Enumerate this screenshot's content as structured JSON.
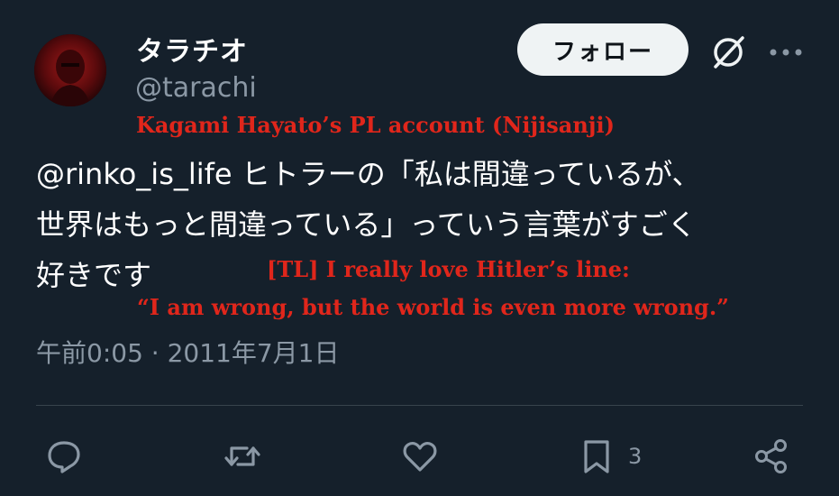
{
  "tweet": {
    "display_name": "タラチオ",
    "handle": "@tarachi",
    "follow_label": "フォロー",
    "text_lines": [
      "@rinko_is_life ヒトラーの「私は間違っているが、",
      "世界はもっと間違っている」っていう言葉がすごく",
      "好きです"
    ],
    "timestamp": "午前0:05 · 2011年7月1日"
  },
  "overlay": {
    "title": "Kagami Hayato’s PL account (Nijisanji)",
    "translation_line1": "[TL] I really love Hitler’s line:",
    "translation_line2": "“I am wrong, but the world is even more wrong.”"
  },
  "actions": {
    "bookmark_count": "3"
  },
  "icons": {
    "header": [
      "grok-icon",
      "more-icon"
    ],
    "actions": [
      "reply-icon",
      "retweet-icon",
      "like-icon",
      "bookmark-icon",
      "share-icon"
    ]
  },
  "colors": {
    "background": "#15202b",
    "text": "#ffffff",
    "muted": "#8b98a5",
    "overlay_red": "#e0261b",
    "follow_button": "#eff3f4"
  }
}
